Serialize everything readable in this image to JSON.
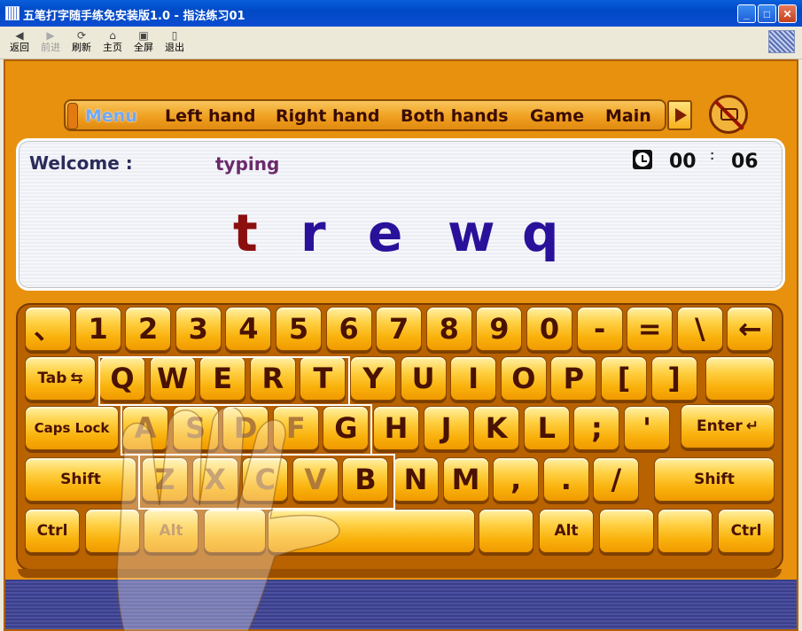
{
  "window": {
    "title": "五笔打字随手练免安装版1.0 - 指法练习01",
    "buttons": {
      "minimize": "_",
      "maximize": "□",
      "close": "✕"
    }
  },
  "toolbar": {
    "back": "返回",
    "forward": "前进",
    "refresh": "刷新",
    "home": "主页",
    "fullscreen": "全屏",
    "exit": "退出"
  },
  "menu": {
    "items": [
      "Menu",
      "Left hand",
      "Right hand",
      "Both hands",
      "Game",
      "Main"
    ],
    "active": "Menu"
  },
  "practice": {
    "welcome": "Welcome :",
    "mode": "typing",
    "timer": {
      "minutes": "00",
      "separator": ":",
      "seconds": "06"
    },
    "letters": [
      "t",
      "r",
      "e",
      "w",
      "q"
    ],
    "current_index": 0
  },
  "keyboard": {
    "row1": [
      "、",
      "1",
      "2",
      "3",
      "4",
      "5",
      "6",
      "7",
      "8",
      "9",
      "0",
      "-",
      "=",
      "\\",
      "←"
    ],
    "row2": [
      "Tab",
      "Q",
      "W",
      "E",
      "R",
      "T",
      "Y",
      "U",
      "I",
      "O",
      "P",
      "[",
      "]"
    ],
    "row3": [
      "Caps Lock",
      "A",
      "S",
      "D",
      "F",
      "G",
      "H",
      "J",
      "K",
      "L",
      ";",
      "'",
      "Enter"
    ],
    "row4": [
      "Shift",
      "Z",
      "X",
      "C",
      "V",
      "B",
      "N",
      "M",
      ",",
      ".",
      "/",
      "Shift"
    ],
    "row5": [
      "Ctrl",
      "",
      "Alt",
      "",
      "",
      "",
      "Alt",
      "",
      "",
      "Ctrl"
    ],
    "tab_glyph": "⇆",
    "enter_glyph": "↵",
    "shift_glyph": "⇧"
  },
  "colors": {
    "stage": "#E8910E",
    "key": "#F9B10C",
    "current_letter": "#8b0f0f",
    "upcoming_letter": "#2a119a",
    "active_menu": "#6ea8ff"
  }
}
